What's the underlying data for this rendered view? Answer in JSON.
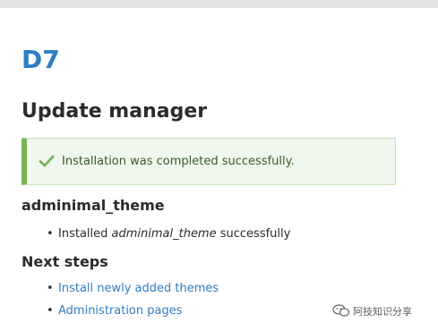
{
  "site": {
    "name": "D7"
  },
  "page": {
    "title": "Update manager"
  },
  "status_message": {
    "icon": "check-icon",
    "text": "Installation was completed successfully.",
    "accent_color": "#77b259"
  },
  "project": {
    "name": "adminimal_theme",
    "result_prefix": "Installed ",
    "result_name": "adminimal_theme",
    "result_suffix": " successfully"
  },
  "next_steps": {
    "title": "Next steps",
    "links": [
      {
        "label": "Install newly added themes"
      },
      {
        "label": "Administration pages"
      }
    ]
  },
  "watermark": {
    "text": "阿技知识分享",
    "icon": "wechat-icon"
  },
  "colors": {
    "link": "#2f7ec2",
    "success_bg": "#f0f7ec"
  }
}
